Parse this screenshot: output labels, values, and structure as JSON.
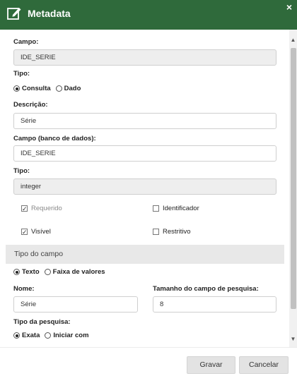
{
  "dialog": {
    "title": "Metadata",
    "close_label": "×"
  },
  "form": {
    "campo_label": "Campo:",
    "campo_value": "IDE_SERIE",
    "tipo_label": "Tipo:",
    "tipo_options": [
      {
        "label": "Consulta",
        "checked": true
      },
      {
        "label": "Dado",
        "checked": false
      }
    ],
    "descricao_label": "Descrição:",
    "descricao_value": "Série",
    "campo_bd_label": "Campo (banco de dados):",
    "campo_bd_value": "IDE_SERIE",
    "tipo2_label": "Tipo:",
    "tipo2_value": "integer",
    "checkboxes": [
      {
        "label": "Requerido",
        "checked": true,
        "disabled": true
      },
      {
        "label": "Identificador",
        "checked": false,
        "disabled": false
      },
      {
        "label": "Visível",
        "checked": true,
        "disabled": false
      },
      {
        "label": "Restritivo",
        "checked": false,
        "disabled": false
      }
    ]
  },
  "section": {
    "header": "Tipo do campo",
    "tipo_options": [
      {
        "label": "Texto",
        "checked": true
      },
      {
        "label": "Faixa de valores",
        "checked": false
      }
    ],
    "nome_label": "Nome:",
    "nome_value": "Série",
    "tamanho_label": "Tamanho do campo de pesquisa:",
    "tamanho_value": "8",
    "pesquisa_label": "Tipo da pesquisa:",
    "pesquisa_options": [
      {
        "label": "Exata",
        "checked": true
      },
      {
        "label": "Iniciar com",
        "checked": false
      }
    ]
  },
  "footer": {
    "save_label": "Gravar",
    "cancel_label": "Cancelar"
  },
  "colors": {
    "titlebar": "#2f6a3b",
    "section_header": "#e8e8e8",
    "button": "#e3e3e3"
  }
}
